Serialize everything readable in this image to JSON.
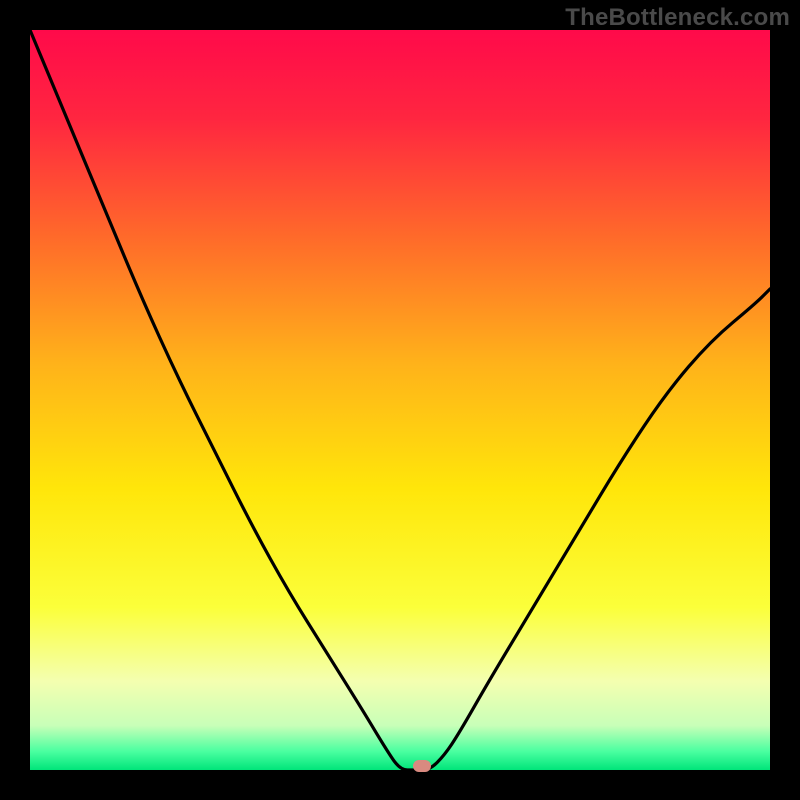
{
  "branding": {
    "watermark": "TheBottleneck.com"
  },
  "chart_data": {
    "type": "line",
    "title": "",
    "xlabel": "",
    "ylabel": "",
    "xlim": [
      0,
      100
    ],
    "ylim": [
      0,
      100
    ],
    "grid": false,
    "legend": false,
    "background_gradient": {
      "stops": [
        {
          "pos": 0.0,
          "color": "#ff0a4a"
        },
        {
          "pos": 0.12,
          "color": "#ff2640"
        },
        {
          "pos": 0.28,
          "color": "#ff6a2a"
        },
        {
          "pos": 0.45,
          "color": "#ffb21a"
        },
        {
          "pos": 0.62,
          "color": "#ffe60a"
        },
        {
          "pos": 0.78,
          "color": "#fbff3a"
        },
        {
          "pos": 0.88,
          "color": "#f4ffb0"
        },
        {
          "pos": 0.94,
          "color": "#c8ffb8"
        },
        {
          "pos": 0.975,
          "color": "#4affa0"
        },
        {
          "pos": 1.0,
          "color": "#00e57a"
        }
      ]
    },
    "series": [
      {
        "name": "bottleneck-curve",
        "color": "#000000",
        "x": [
          0,
          5,
          10,
          15,
          20,
          25,
          30,
          35,
          40,
          45,
          48,
          50,
          52,
          54,
          56,
          58,
          62,
          68,
          74,
          80,
          86,
          92,
          98,
          100
        ],
        "y": [
          100,
          88,
          76,
          64,
          53,
          43,
          33,
          24,
          16,
          8,
          3,
          0,
          0,
          0,
          2,
          5,
          12,
          22,
          32,
          42,
          51,
          58,
          63,
          65
        ]
      }
    ],
    "marker": {
      "x": 53,
      "y": 0.5,
      "color": "#d98a80"
    },
    "notes": "x is an abstract configuration axis (0–100). y is bottleneck severity (%). Curve minimum ≈ x 50–54 where bottleneck ≈ 0."
  }
}
